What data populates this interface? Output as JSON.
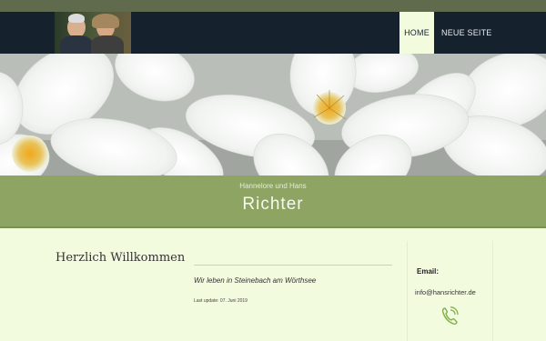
{
  "nav": {
    "menu": [
      {
        "label": "HOME",
        "active": true
      },
      {
        "label": "NEUE SEITE",
        "active": false
      }
    ]
  },
  "banner": {
    "subtitle": "Hannelore und Hans",
    "title": "Richter"
  },
  "main": {
    "heading": "Herzlich Willkommen",
    "motto": "Wir leben in Steinebach am Wörthsee",
    "last_update": "Last update: 07. Juni 2019"
  },
  "sidebar": {
    "email_label": "Email:",
    "email_value": "info@hansrichter.de"
  },
  "colors": {
    "nav_bg": "#15222e",
    "banner_green": "#8da463",
    "content_bg": "#f3fbdf",
    "icon_green": "#7fb04a"
  },
  "icons": {
    "contact": "phone-icon"
  }
}
